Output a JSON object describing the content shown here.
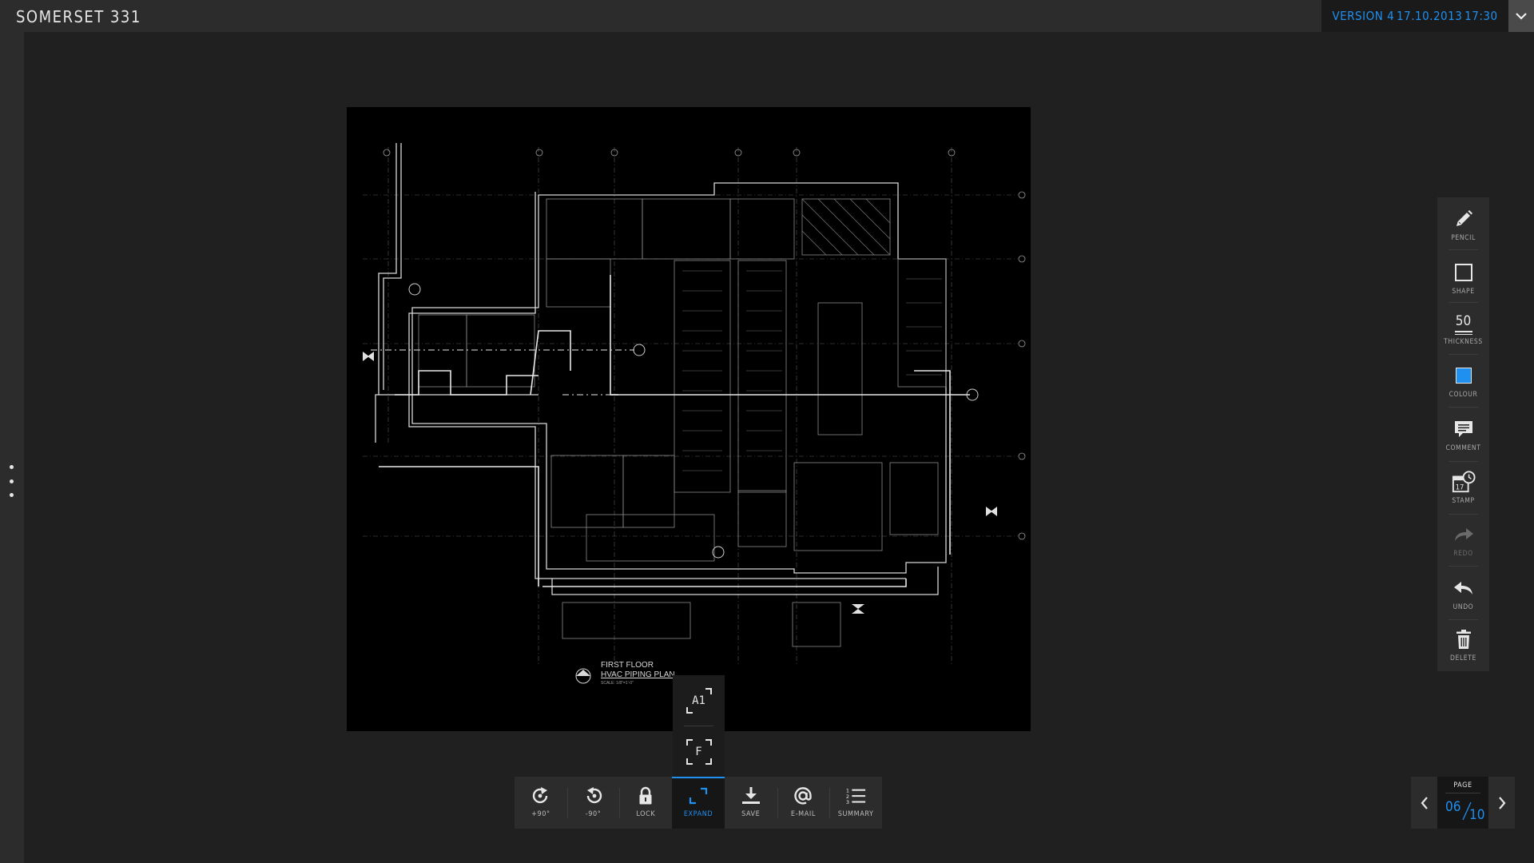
{
  "app": {
    "title": "SOMERSET 331",
    "version": "VERSION 4",
    "date": "17.10.2013",
    "time": "17:30",
    "accent_color": "#1f8ff0"
  },
  "drawing": {
    "title_line1": "FIRST FLOOR",
    "title_line2": "HVAC PIPING PLAN",
    "scale": "SCALE: 1/8\"=1'-0\""
  },
  "expand_menu": {
    "items": [
      {
        "label": "A1",
        "icon": "a1-frame-icon"
      },
      {
        "label": "F",
        "icon": "fit-frame-icon"
      }
    ]
  },
  "toolbar": {
    "buttons": [
      {
        "label": "+90°",
        "icon": "rotate-cw-icon",
        "active": false
      },
      {
        "label": "-90°",
        "icon": "rotate-ccw-icon",
        "active": false
      },
      {
        "label": "LOCK",
        "icon": "lock-icon",
        "active": false
      },
      {
        "label": "EXPAND",
        "icon": "expand-icon",
        "active": true
      },
      {
        "label": "SAVE",
        "icon": "download-icon",
        "active": false
      },
      {
        "label": "E-MAIL",
        "icon": "at-icon",
        "active": false
      },
      {
        "label": "SUMMARY",
        "icon": "numbered-list-icon",
        "active": false
      }
    ]
  },
  "tools": {
    "items": [
      {
        "label": "PENCIL",
        "icon": "pencil-icon",
        "enabled": true
      },
      {
        "label": "SHAPE",
        "icon": "square-icon",
        "enabled": true
      },
      {
        "label": "THICKNESS",
        "icon": "thickness-icon",
        "value": "50",
        "enabled": true
      },
      {
        "label": "COLOUR",
        "icon": "color-swatch-icon",
        "color": "#1f8ff0",
        "enabled": true
      },
      {
        "label": "COMMENT",
        "icon": "comment-icon",
        "enabled": true
      },
      {
        "label": "STAMP",
        "icon": "stamp-icon",
        "stamp_number": "17",
        "enabled": true
      },
      {
        "label": "REDO",
        "icon": "redo-icon",
        "enabled": false
      },
      {
        "label": "UNDO",
        "icon": "undo-icon",
        "enabled": true
      },
      {
        "label": "DELETE",
        "icon": "trash-icon",
        "enabled": true
      }
    ]
  },
  "pagination": {
    "label": "PAGE",
    "current": "06",
    "total": "10"
  }
}
